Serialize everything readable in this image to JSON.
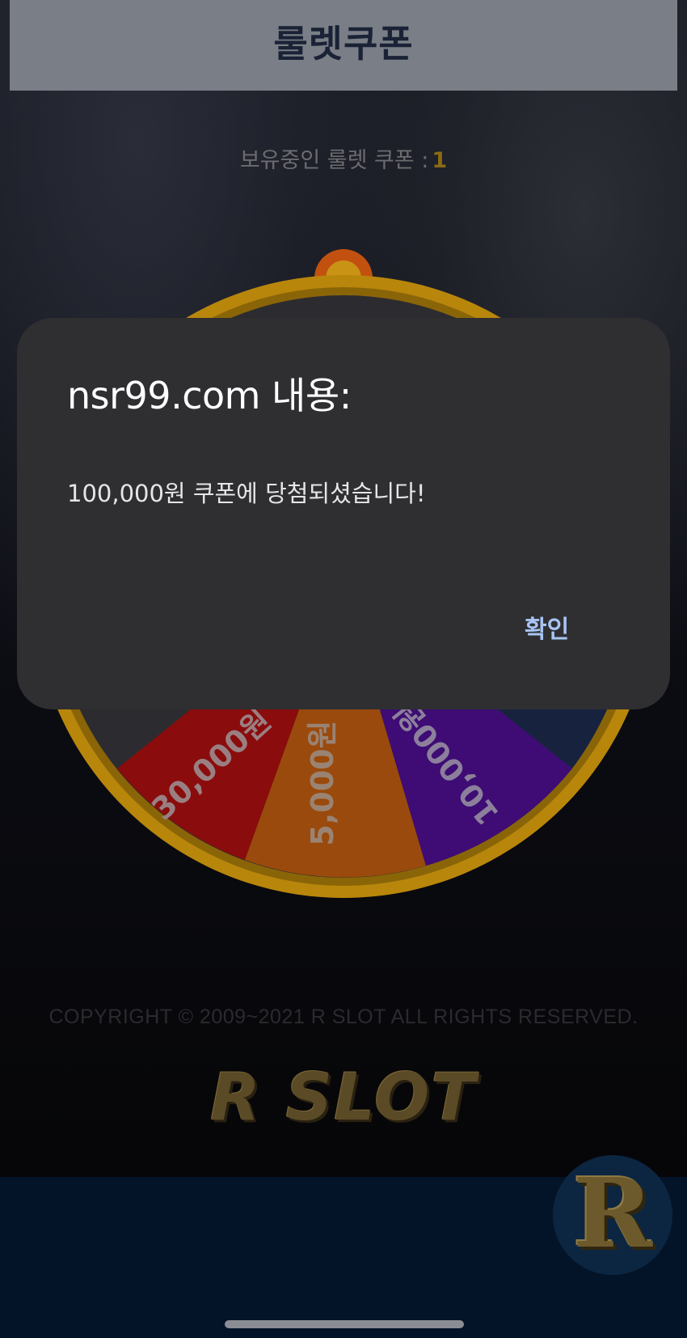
{
  "header": {
    "title": "룰렛쿠폰"
  },
  "coupon": {
    "label": "보유중인 룰렛 쿠폰 :",
    "count": "1"
  },
  "wheel": {
    "segments": [
      {
        "label": "30,000원",
        "color": "#8a0c0c"
      },
      {
        "label": "5,000원",
        "color": "#9a4a0c"
      },
      {
        "label": "10,000원",
        "color": "#3e0c74"
      }
    ],
    "rim_color": "#b8860b",
    "pointer_color": "#c2510f"
  },
  "footer": {
    "copyright": "COPYRIGHT © 2009~2021 R SLOT ALL RIGHTS RESERVED.",
    "logo": "R SLOT",
    "badge_letter": "R"
  },
  "dialog": {
    "title": "nsr99.com 내용:",
    "message": "100,000원 쿠폰에 당첨되셨습니다!",
    "ok_label": "확인"
  }
}
